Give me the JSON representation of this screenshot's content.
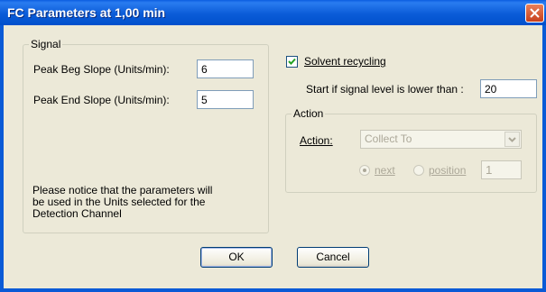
{
  "window": {
    "title": "FC Parameters at 1,00 min"
  },
  "signal": {
    "legend": "Signal",
    "peak_beg_label": "Peak Beg Slope (Units/min):",
    "peak_beg_value": "6",
    "peak_end_label": "Peak End Slope (Units/min):",
    "peak_end_value": "5",
    "notice": [
      "Please notice that the parameters will",
      "be used in the Units selected for the",
      "Detection Channel"
    ]
  },
  "solvent": {
    "checkbox_label": "Solvent recycling",
    "checked": true,
    "start_label": "Start if signal level is lower than :",
    "start_value": "20"
  },
  "action": {
    "legend": "Action",
    "action_label": "Action:",
    "action_value": "Collect To",
    "next_label": "next",
    "position_label": "position",
    "position_value": "1"
  },
  "buttons": {
    "ok": "OK",
    "cancel": "Cancel"
  },
  "icons": {
    "close": "close-icon",
    "check": "check-icon",
    "dropdown": "chevron-down-icon"
  }
}
